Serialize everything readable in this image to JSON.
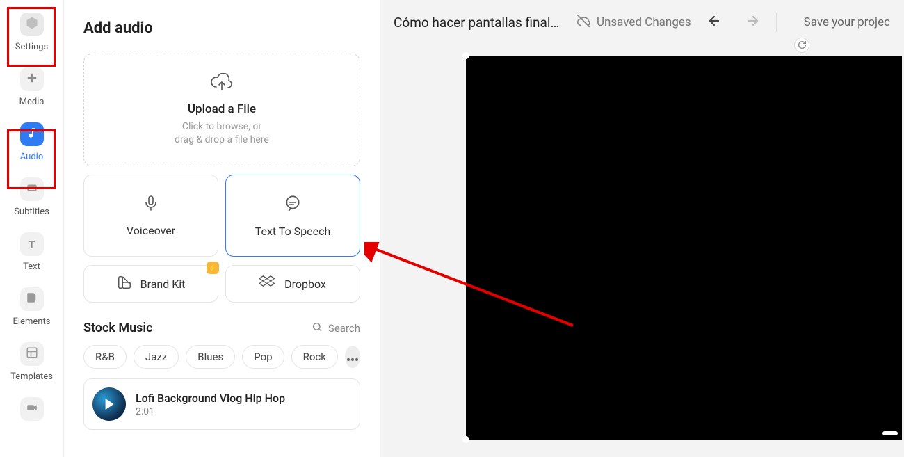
{
  "sidebar": {
    "items": [
      {
        "label": "Settings"
      },
      {
        "label": "Media"
      },
      {
        "label": "Audio"
      },
      {
        "label": "Subtitles"
      },
      {
        "label": "Text"
      },
      {
        "label": "Elements"
      },
      {
        "label": "Templates"
      }
    ]
  },
  "panel": {
    "title": "Add audio",
    "upload": {
      "title": "Upload a File",
      "sub": "Click to browse, or\ndrag & drop a file here"
    },
    "cards": {
      "voiceover": "Voiceover",
      "tts": "Text To Speech",
      "brandkit": "Brand Kit",
      "dropbox": "Dropbox"
    },
    "stock": {
      "title": "Stock Music",
      "search": "Search",
      "genres": [
        "R&B",
        "Jazz",
        "Blues",
        "Pop",
        "Rock"
      ]
    },
    "track": {
      "title": "Lofi Background Vlog Hip Hop",
      "duration": "2:01"
    }
  },
  "topbar": {
    "project_title": "Cómo hacer pantallas final...",
    "unsaved": "Unsaved Changes",
    "save_hint": "Save your projec"
  }
}
